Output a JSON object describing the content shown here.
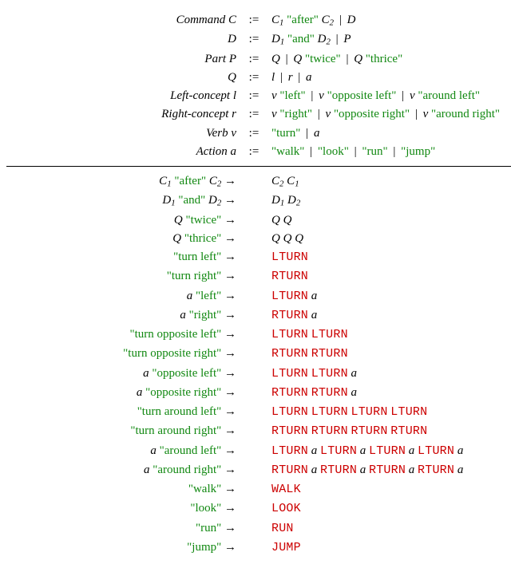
{
  "sym": {
    "coloneq": ":=",
    "arrow": "→",
    "pipe": "|"
  },
  "nt": {
    "CommandC": "Command C",
    "C": "C",
    "C1": "C",
    "C1s": "1",
    "C2": "C",
    "C2s": "2",
    "D": "D",
    "D1": "D",
    "D1s": "1",
    "D2": "D",
    "D2s": "2",
    "PartP": "Part P",
    "P": "P",
    "Q": "Q",
    "Leftl": "Left-concept l",
    "l": "l",
    "Rightr": "Right-concept r",
    "r": "r",
    "Verbv": "Verb v",
    "v": "v",
    "Actiona": "Action a",
    "a": "a"
  },
  "t": {
    "after": "\"after\"",
    "and": "\"and\"",
    "twice": "\"twice\"",
    "thrice": "\"thrice\"",
    "left": "\"left\"",
    "right": "\"right\"",
    "opleft": "\"opposite left\"",
    "opright": "\"opposite right\"",
    "arleft": "\"around left\"",
    "arright": "\"around right\"",
    "turn": "\"turn\"",
    "walk": "\"walk\"",
    "look": "\"look\"",
    "run": "\"run\"",
    "jump": "\"jump\"",
    "tleft": "\"turn left\"",
    "tright": "\"turn right\"",
    "topleft": "\"turn opposite left\"",
    "topright": "\"turn opposite right\"",
    "tarleft": "\"turn around left\"",
    "tarright": "\"turn around right\""
  },
  "act": {
    "LTURN": "LTURN",
    "RTURN": "RTURN",
    "WALK": "WALK",
    "LOOK": "LOOK",
    "RUN": "RUN",
    "JUMP": "JUMP"
  }
}
